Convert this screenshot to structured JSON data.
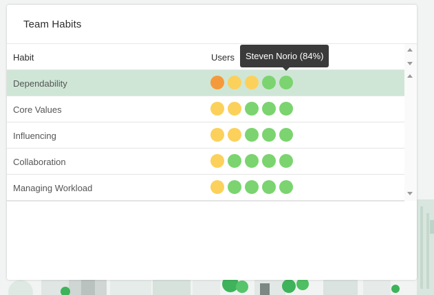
{
  "card": {
    "title": "Team Habits"
  },
  "table": {
    "columns": [
      "Habit",
      "Users"
    ],
    "rows": [
      {
        "habit": "Dependability",
        "selected": true,
        "users": [
          "orange",
          "yellow",
          "yellow",
          "green",
          "green"
        ]
      },
      {
        "habit": "Core Values",
        "selected": false,
        "users": [
          "yellow",
          "yellow",
          "green",
          "green",
          "green"
        ]
      },
      {
        "habit": "Influencing",
        "selected": false,
        "users": [
          "yellow",
          "yellow",
          "green",
          "green",
          "green"
        ]
      },
      {
        "habit": "Collaboration",
        "selected": false,
        "users": [
          "yellow",
          "green",
          "green",
          "green",
          "green"
        ]
      },
      {
        "habit": "Managing Workload",
        "selected": false,
        "users": [
          "yellow",
          "green",
          "green",
          "green",
          "green"
        ]
      }
    ]
  },
  "tooltip": {
    "text": "Steven Norio (84%)"
  },
  "colors": {
    "orange": "#f59a3a",
    "yellow": "#fbd15b",
    "green": "#7bd46f",
    "selected_row": "#cfe6d6"
  }
}
